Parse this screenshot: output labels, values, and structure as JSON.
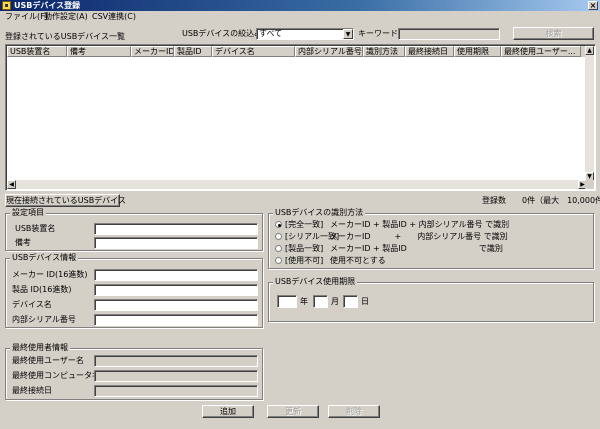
{
  "window": {
    "title": "USBデバイス登録",
    "close_label": "×"
  },
  "menu": [
    {
      "label": "ファイル(F)"
    },
    {
      "label": "動作設定(A)"
    },
    {
      "label": "CSV連携(C)"
    }
  ],
  "list": {
    "title": "登録されているUSBデバイス一覧",
    "filter_label": "USBデバイスの絞込み",
    "filter_value": "すべて",
    "keyword_label": "キーワード",
    "keyword_value": "",
    "search_label": "検索",
    "columns": [
      "USB装置名",
      "備考",
      "メーカーID",
      "製品ID",
      "デバイス名",
      "内部シリアル番号",
      "識別方法",
      "最終接続日",
      "使用期限",
      "最終使用ユーザー..."
    ]
  },
  "connected_button": "現在接続されているUSBデバイス",
  "count": {
    "label": "登録数",
    "value": "0件（最大　10,000件）"
  },
  "settings": {
    "title": "設定項目",
    "name_label": "USB装置名",
    "name_value": "",
    "note_label": "備考",
    "note_value": ""
  },
  "device": {
    "title": "USBデバイス情報",
    "vendor_label": "メーカー ID(16進数)",
    "vendor_value": "",
    "product_label": "製品 ID(16進数)",
    "product_value": "",
    "devname_label": "デバイス名",
    "devname_value": "",
    "serial_label": "内部シリアル番号",
    "serial_value": ""
  },
  "last_user": {
    "title": "最終使用者情報",
    "user_label": "最終使用ユーザー名",
    "user_value": "",
    "computer_label": "最終使用コンピュータ名",
    "computer_value": "",
    "date_label": "最終接続日",
    "date_value": ""
  },
  "identify": {
    "title": "USBデバイスの識別方法",
    "options": [
      {
        "label": "[完全一致]",
        "desc": "メーカーID + 製品ID + 内部シリアル番号 で識別",
        "checked": true
      },
      {
        "label": "[シリアル一致]",
        "desc": "メーカーID　　　+　　内部シリアル番号 で識別",
        "checked": false
      },
      {
        "label": "[製品一致]",
        "desc": "メーカーID + 製品ID　　　　　　　　　で識別",
        "checked": false
      },
      {
        "label": "[使用不可]",
        "desc": "使用不可とする",
        "checked": false
      }
    ]
  },
  "expiry": {
    "title": "USBデバイス使用期限",
    "year_label": "年",
    "month_label": "月",
    "day_label": "日",
    "year_value": "",
    "month_value": "",
    "day_value": ""
  },
  "actions": {
    "add": "追加",
    "update": "更新",
    "delete": "削除"
  }
}
